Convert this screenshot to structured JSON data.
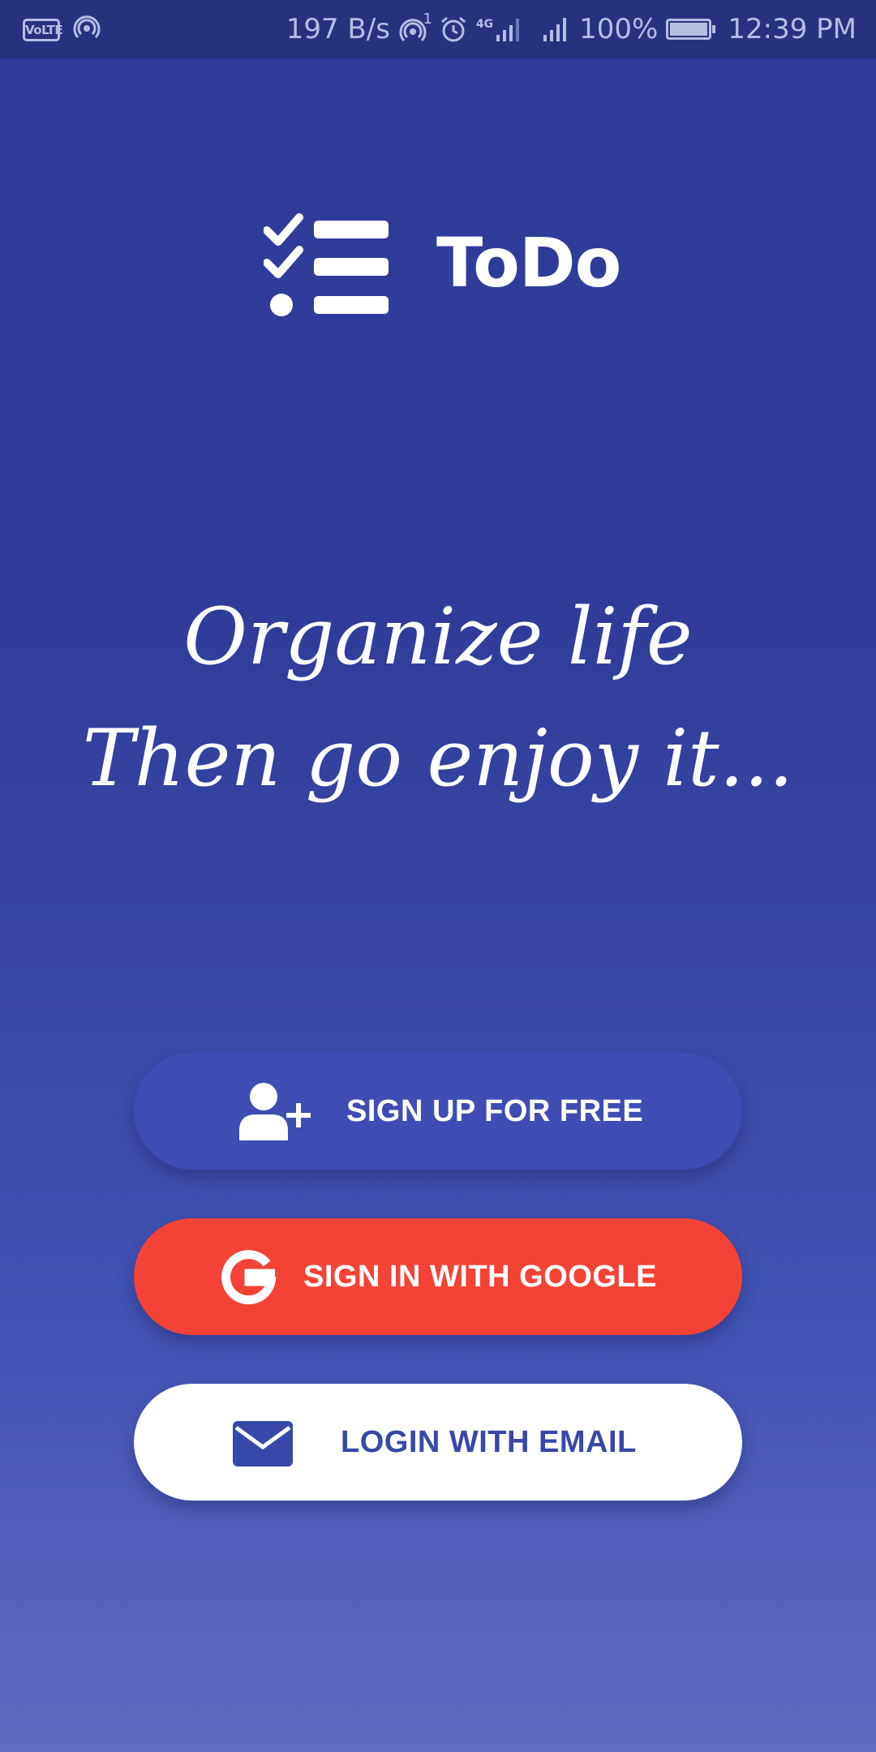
{
  "status_bar": {
    "left_icons": [
      "volte-icon",
      "hotspot-icon"
    ],
    "volte_label": "VoLTE",
    "network_speed": "197 B/s",
    "hotspot_count": "1",
    "network_type": "4G",
    "battery_percent": "100%",
    "time": "12:39 PM"
  },
  "logo": {
    "icon": "checklist-icon",
    "app_name": "ToDo"
  },
  "tagline": {
    "line1": "Organize life",
    "line2": "Then go enjoy it..."
  },
  "buttons": {
    "signup": {
      "icon": "add-user-icon",
      "label": "SIGN UP FOR FREE"
    },
    "google": {
      "icon": "google-icon",
      "label": "SIGN IN WITH GOOGLE"
    },
    "email": {
      "icon": "envelope-icon",
      "label": "LOGIN WITH EMAIL"
    }
  },
  "colors": {
    "background": "#2f3c9a",
    "status_bar": "#27327f",
    "signup_button": "#3d4db3",
    "google_button": "#f44336",
    "email_button": "#ffffff",
    "email_text": "#3848a8"
  }
}
